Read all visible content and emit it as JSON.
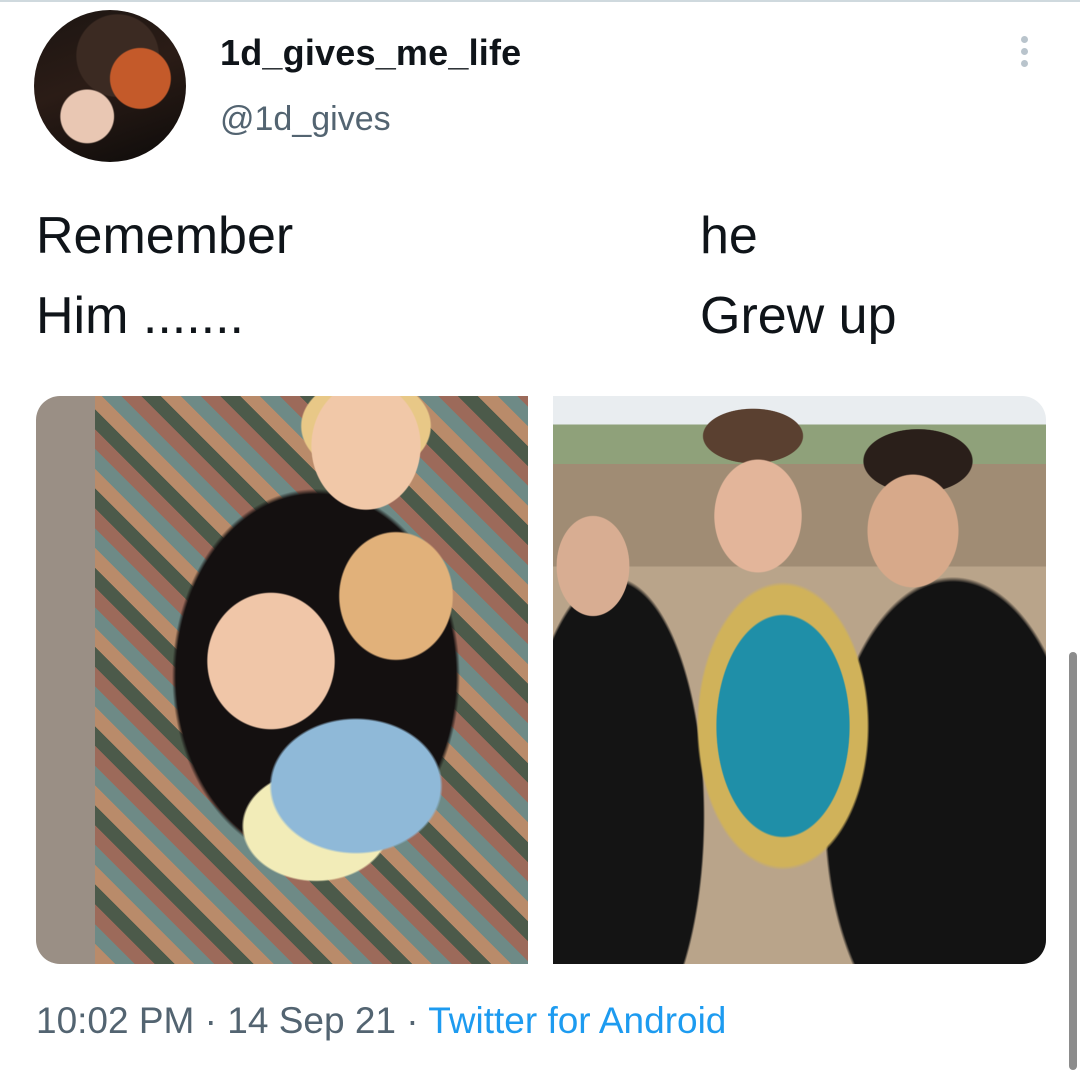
{
  "tweet": {
    "display_name": "1d_gives_me_life",
    "handle": "@1d_gives",
    "text_left": "Remember\nHim .......",
    "text_right": "he\nGrew up",
    "timestamp_time": "10:02 PM",
    "separator": " · ",
    "timestamp_date": "14 Sep 21",
    "source_app": "Twitter for Android"
  },
  "colors": {
    "text_primary": "#0f1419",
    "text_secondary": "#536471",
    "link_blue": "#1d9bf0"
  },
  "icons": {
    "more": "more-vertical-icon"
  }
}
